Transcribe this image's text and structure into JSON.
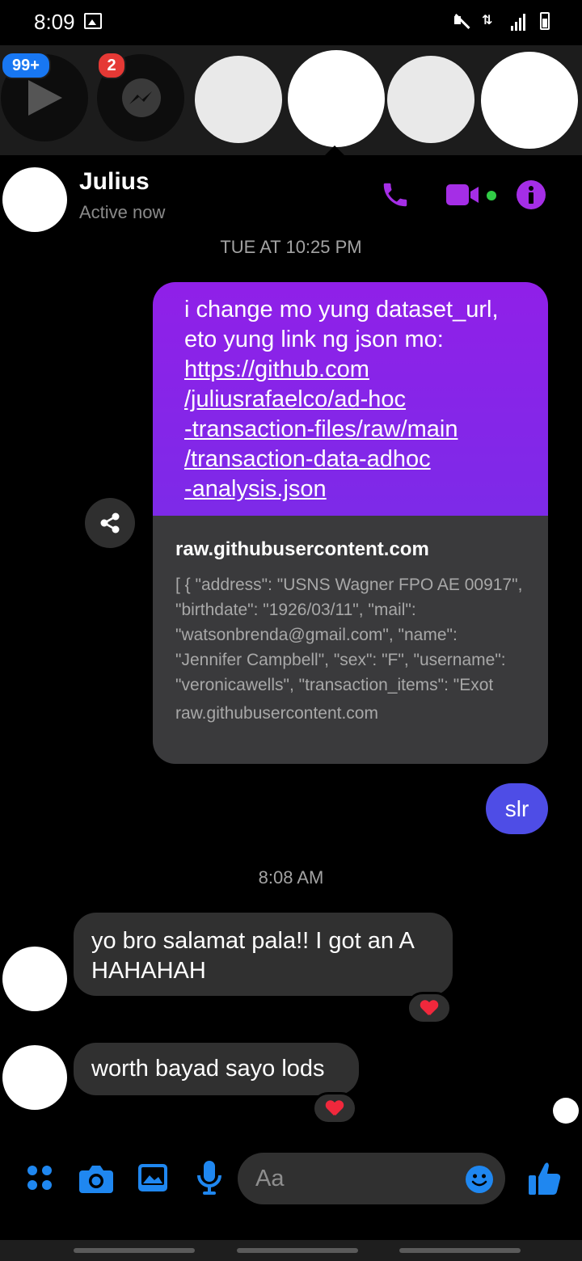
{
  "status_bar": {
    "time": "8:09"
  },
  "chat_heads": {
    "badge_unread": "99+",
    "badge_messenger": "2"
  },
  "header": {
    "name": "Julius",
    "status": "Active now"
  },
  "timestamps": {
    "first": "TUE AT 10:25 PM",
    "second": "8:08 AM"
  },
  "outgoing_message": {
    "text": "i change mo yung dataset_url, eto yung link ng json mo:",
    "link_lines": [
      "https://github.com",
      "/juliusrafaelco/ad-hoc",
      "-transaction-files/raw/main",
      "/transaction-data-adhoc",
      "-analysis.json"
    ]
  },
  "link_preview": {
    "title": "raw.githubusercontent.com",
    "snippet": "[ { \"address\": \"USNS Wagner FPO AE 00917\", \"birthdate\": \"1926/03/11\", \"mail\": \"watsonbrenda@gmail.com\", \"name\": \"Jennifer Campbell\", \"sex\": \"F\", \"username\": \"veronicawells\", \"transaction_items\": \"Exot",
    "domain": "raw.githubusercontent.com"
  },
  "outgoing_short": "slr",
  "incoming_messages": [
    {
      "text": "yo bro salamat pala!! I got an A HAHAHAH"
    },
    {
      "text": "worth bayad sayo lods"
    }
  ],
  "composer": {
    "placeholder": "Aa"
  },
  "colors": {
    "accent_purple": "#a52ee6",
    "composer_blue": "#1f87f0",
    "slr_bubble": "#4e4de6",
    "heart": "#f0283c"
  }
}
